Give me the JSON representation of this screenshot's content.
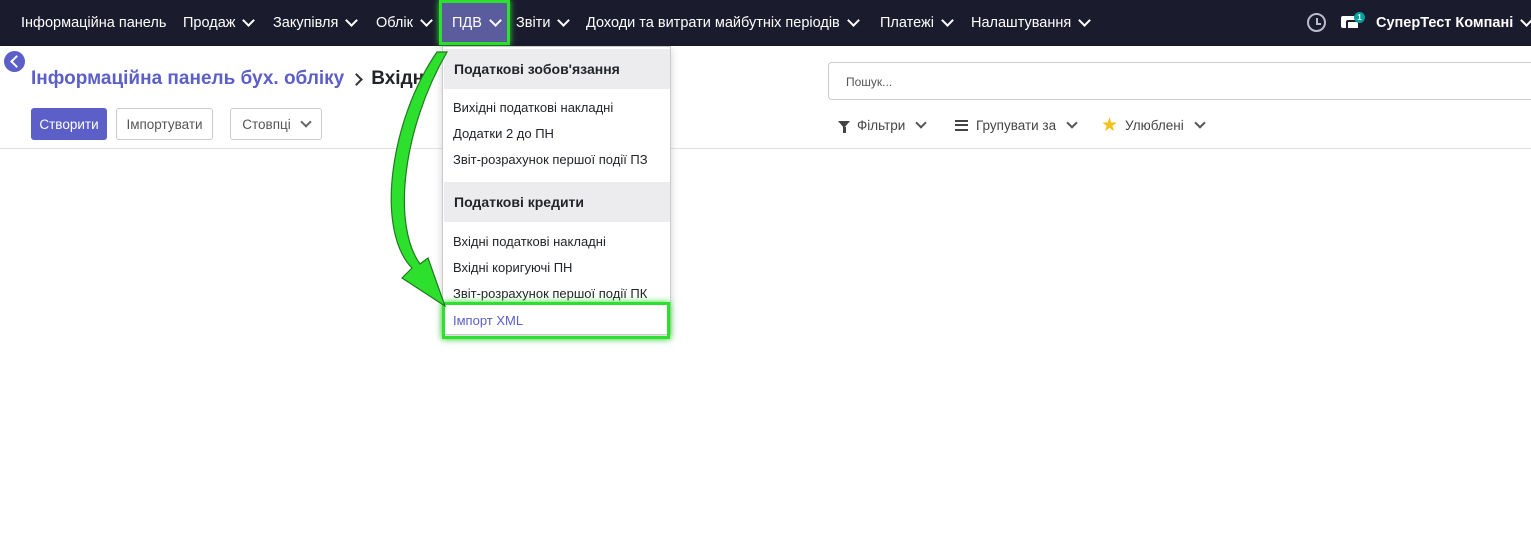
{
  "navbar": {
    "items": [
      {
        "label": "Інформаційна панель"
      },
      {
        "label": "Продаж"
      },
      {
        "label": "Закупівля"
      },
      {
        "label": "Облік"
      },
      {
        "label": "ПДВ"
      },
      {
        "label": "Звіти"
      },
      {
        "label": "Доходи та витрати майбутніх періодів"
      },
      {
        "label": "Платежі"
      },
      {
        "label": "Налаштування"
      }
    ],
    "chat_badge": "1",
    "company": "СуперТест Компані"
  },
  "breadcrumb": {
    "parent": "Інформаційна панель бух. обліку",
    "current": "Вхідні"
  },
  "buttons": {
    "create": "Створити",
    "import": "Імпортувати",
    "columns": "Стовпці"
  },
  "search": {
    "placeholder": "Пошук..."
  },
  "search_panel": {
    "filters": "Фільтри",
    "group_by": "Групувати за",
    "favorites": "Улюблені"
  },
  "dropdown": {
    "section1": {
      "title": "Податкові зобов'язання",
      "items": [
        "Вихідні податкові накладні",
        "Додатки 2 до ПН",
        "Звіт-розрахунок першої події ПЗ"
      ]
    },
    "section2": {
      "title": "Податкові кредити",
      "items": [
        "Вхідні податкові накладні",
        "Вхідні коригуючі ПН",
        "Звіт-розрахунок першої події ПК",
        "Імпорт XML"
      ]
    }
  },
  "colors": {
    "navbar_bg": "#1b1b2e",
    "accent": "#5b5fc7",
    "highlight": "#2ee02e"
  }
}
